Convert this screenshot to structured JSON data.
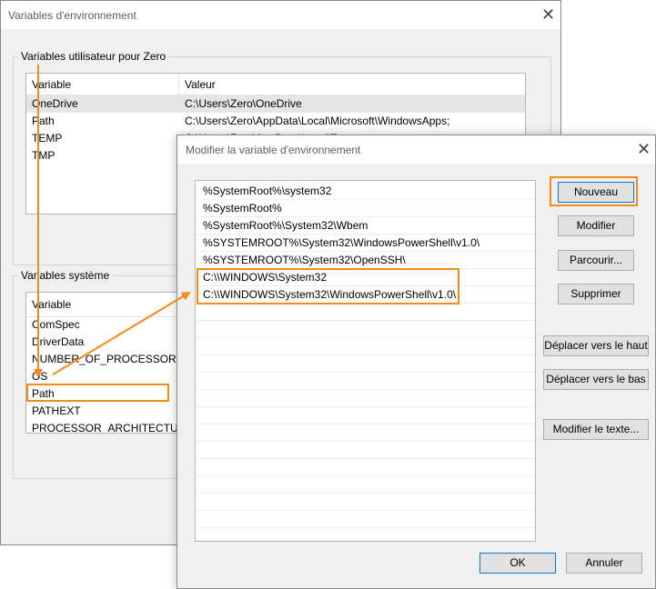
{
  "back_window": {
    "title": "Variables d'environnement",
    "close_glyph": "✕",
    "user_group": {
      "label": "Variables utilisateur pour Zero",
      "col_variable": "Variable",
      "col_value": "Valeur",
      "rows": [
        {
          "variable": "OneDrive",
          "value": "C:\\Users\\Zero\\OneDrive"
        },
        {
          "variable": "Path",
          "value": "C:\\Users\\Zero\\AppData\\Local\\Microsoft\\WindowsApps;"
        },
        {
          "variable": "TEMP",
          "value": "C:\\Users\\Zero\\AppData\\Local\\Temp"
        },
        {
          "variable": "TMP",
          "value": ""
        }
      ]
    },
    "system_group": {
      "label": "Variables système",
      "col_variable": "Variable",
      "rows": [
        {
          "variable": "ComSpec"
        },
        {
          "variable": "DriverData"
        },
        {
          "variable": "NUMBER_OF_PROCESSORS"
        },
        {
          "variable": "OS"
        },
        {
          "variable": "Path"
        },
        {
          "variable": "PATHEXT"
        },
        {
          "variable": "PROCESSOR_ARCHITECTURE"
        }
      ]
    }
  },
  "front_dialog": {
    "title": "Modifier la variable d'environnement",
    "close_glyph": "✕",
    "entries": [
      "%SystemRoot%\\system32",
      "%SystemRoot%",
      "%SystemRoot%\\System32\\Wbem",
      "%SYSTEMROOT%\\System32\\WindowsPowerShell\\v1.0\\",
      "%SYSTEMROOT%\\System32\\OpenSSH\\",
      "C:\\\\WINDOWS\\System32",
      "C:\\\\WINDOWS\\System32\\WindowsPowerShell\\v1.0\\"
    ],
    "buttons": {
      "new": "Nouveau",
      "edit": "Modifier",
      "browse": "Parcourir...",
      "delete": "Supprimer",
      "move_up": "Déplacer vers le haut",
      "move_down": "Déplacer vers le bas",
      "edit_text": "Modifier le texte...",
      "ok": "OK",
      "cancel": "Annuler"
    }
  },
  "colors": {
    "highlight": "#f28c17",
    "selected_row": "#e5e5e5"
  }
}
